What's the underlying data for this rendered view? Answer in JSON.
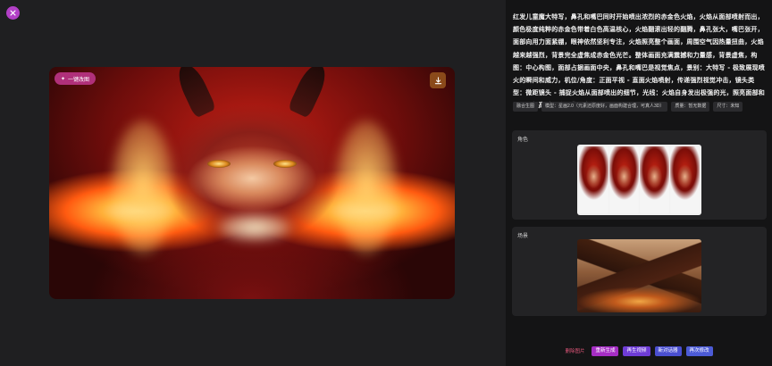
{
  "image_badge": {
    "label": "一键改图",
    "icon": "sparkle-icon"
  },
  "prompt_text": "红发儿童魔大特写，鼻孔和嘴巴同时开始喷出浓烈的赤金色火焰，火焰从面部喷射而出，颜色极度纯粹的赤金色带着白色高温核心，火焰翻滚出轻的翻腾，鼻孔张大，嘴巴张开，面部向用力面紧绷，眼神依然坚利专注，火焰照亮整个画面，周围空气因热量扭曲，火焰越来越强烈，背景完全虚焦成赤金色光芒。整体画面充满震撼和力量感，背景虚焦，构图：中心构图，面部占据画面中央，鼻孔和嘴巴是视觉焦点，景别：大特写 - 极致展现喷火的瞬间和威力，机位/角度：正面平视 - 直面火焰喷射，传递强烈视觉冲击，镜头类型：微距镜头 - 捕捉火焰从面部喷出的细节，光线：火焰自身发出极强的光，照亮面部和周围，极高对比度，背景虚焦",
  "tags": [
    "融合生图",
    "模型：星画2.0（元素还原度好，画面构建合理，可真人3D）",
    "质量：暂无数据",
    "尺寸：未知"
  ],
  "reference_cards": {
    "role_label": "角色",
    "scene_label": "场景"
  },
  "footer": {
    "prefix_text": "删除图片",
    "buttons": [
      "重新生成",
      "再生视频",
      "新对话器",
      "再次修改"
    ]
  },
  "colors": {
    "accent_purple": "#b23fc6",
    "badge_pink": "#b0307a",
    "footer_text": "#e0567a"
  }
}
